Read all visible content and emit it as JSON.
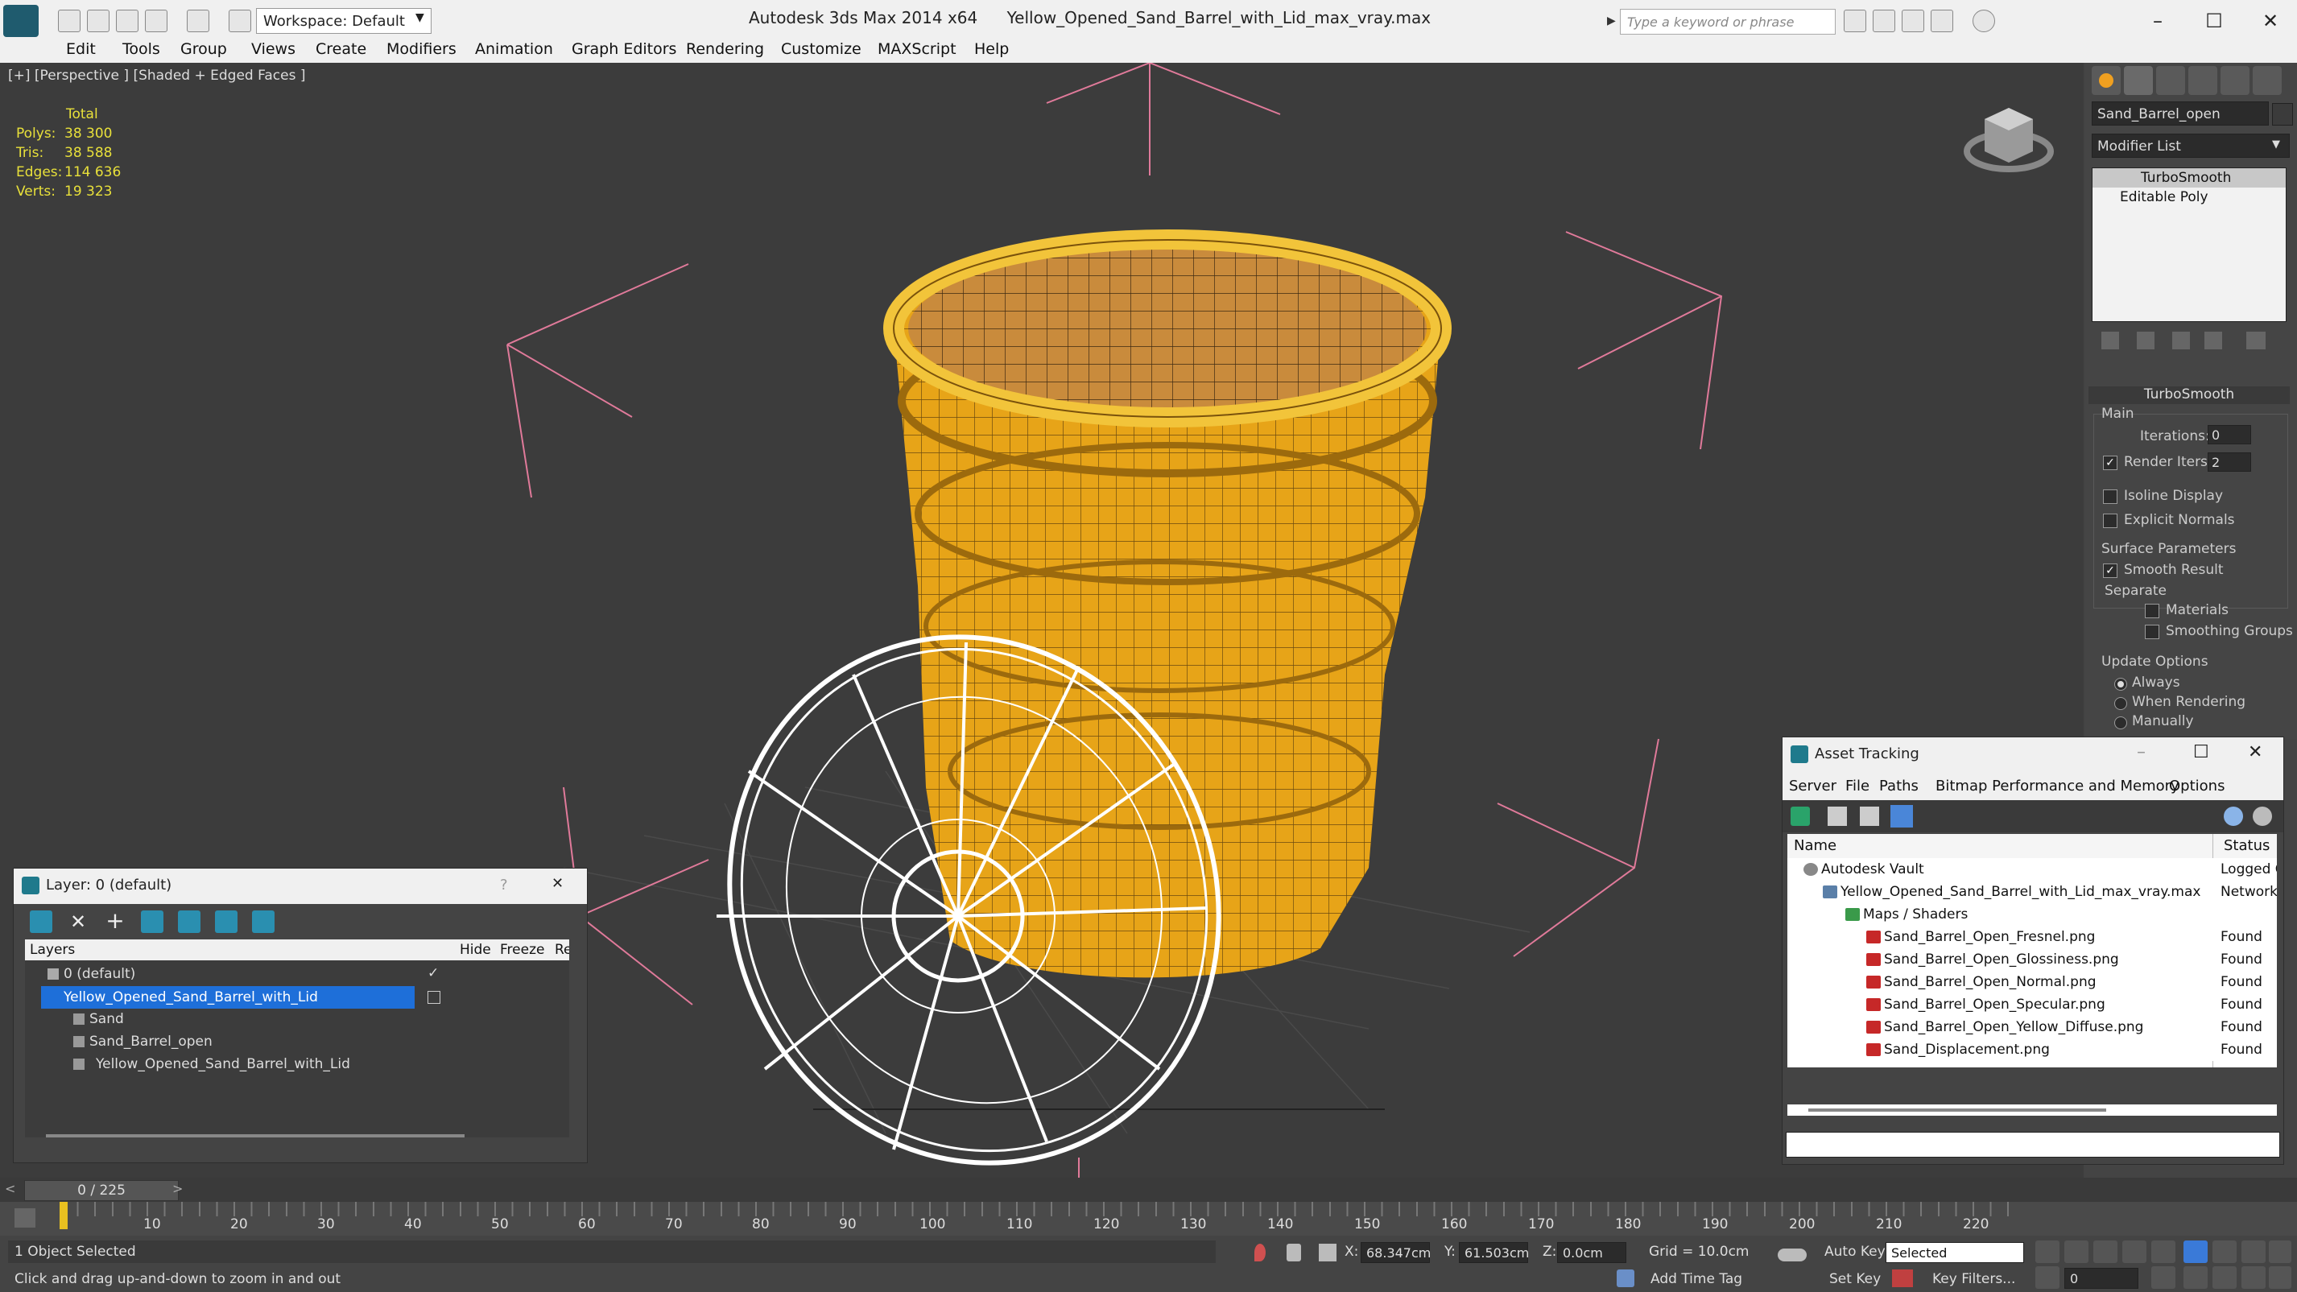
{
  "app": {
    "name": "Autodesk 3ds Max  2014 x64",
    "file": "Yellow_Opened_Sand_Barrel_with_Lid_max_vray.max",
    "workspace": "Workspace: Default",
    "search_placeholder": "Type a keyword or phrase"
  },
  "menu": [
    "Edit",
    "Tools",
    "Group",
    "Views",
    "Create",
    "Modifiers",
    "Animation",
    "Graph Editors",
    "Rendering",
    "Customize",
    "MAXScript",
    "Help"
  ],
  "viewport": {
    "label": "[+] [Perspective ] [Shaded + Edged Faces ]",
    "stats": {
      "total_label": "Total",
      "polys_label": "Polys:",
      "polys": "38 300",
      "tris_label": "Tris:",
      "tris": "38 588",
      "edges_label": "Edges:",
      "edges": "114 636",
      "verts_label": "Verts:",
      "verts": "19 323"
    },
    "colors": {
      "barrel": "#e7a418",
      "sand": "#c98b3c",
      "wire": "#ffffff",
      "gizmo": "#e07a9a"
    }
  },
  "command_panel": {
    "object_name": "Sand_Barrel_open",
    "modifier_list": "Modifier List",
    "stack": [
      "TurboSmooth",
      "Editable Poly"
    ],
    "rollout_title": "TurboSmooth",
    "main_label": "Main",
    "iterations_label": "Iterations:",
    "iterations": "0",
    "render_iters_label": "Render Iters:",
    "render_iters": "2",
    "isoline_label": "Isoline Display",
    "explicit_label": "Explicit Normals",
    "surface_label": "Surface Parameters",
    "smooth_result_label": "Smooth Result",
    "separate_label": "Separate",
    "materials_label": "Materials",
    "smoothing_label": "Smoothing Groups",
    "update_label": "Update Options",
    "always_label": "Always",
    "when_rendering_label": "When Rendering",
    "manually_label": "Manually"
  },
  "layer_panel": {
    "title": "Layer: 0 (default)",
    "help": "?",
    "close": "✕",
    "col_layers": "Layers",
    "col_hide": "Hide",
    "col_freeze": "Freeze",
    "col_render": "Rend",
    "rows": [
      {
        "name": "0 (default)",
        "check": "✓"
      },
      {
        "name": "Yellow_Opened_Sand_Barrel_with_Lid",
        "check": ""
      },
      {
        "name": "Sand",
        "check": ""
      },
      {
        "name": "Sand_Barrel_open",
        "check": ""
      },
      {
        "name": "Yellow_Opened_Sand_Barrel_with_Lid",
        "check": ""
      }
    ]
  },
  "asset_panel": {
    "title": "Asset Tracking",
    "menu": [
      "Server",
      "File",
      "Paths",
      "Bitmap Performance and Memory",
      "Options"
    ],
    "col_name": "Name",
    "col_status": "Status",
    "rows": [
      {
        "name": "Autodesk Vault",
        "status": "Logged O"
      },
      {
        "name": "Yellow_Opened_Sand_Barrel_with_Lid_max_vray.max",
        "status": "Network F"
      },
      {
        "name": "Maps / Shaders",
        "status": ""
      },
      {
        "name": "Sand_Barrel_Open_Fresnel.png",
        "status": "Found"
      },
      {
        "name": "Sand_Barrel_Open_Glossiness.png",
        "status": "Found"
      },
      {
        "name": "Sand_Barrel_Open_Normal.png",
        "status": "Found"
      },
      {
        "name": "Sand_Barrel_Open_Specular.png",
        "status": "Found"
      },
      {
        "name": "Sand_Barrel_Open_Yellow_Diffuse.png",
        "status": "Found"
      },
      {
        "name": "Sand_Displacement.png",
        "status": "Found"
      }
    ]
  },
  "timeline": {
    "frame": "0 / 225",
    "ticks": [
      "10",
      "20",
      "30",
      "40",
      "50",
      "60",
      "70",
      "80",
      "90",
      "100",
      "110",
      "120",
      "130",
      "140",
      "150",
      "160",
      "170",
      "180",
      "190",
      "200",
      "210",
      "220"
    ]
  },
  "status": {
    "selected": "1 Object Selected",
    "hint": "Click and drag up-and-down to zoom in and out",
    "x_label": "X:",
    "x": "68.347cm",
    "y_label": "Y:",
    "y": "61.503cm",
    "z_label": "Z:",
    "z": "0.0cm",
    "grid": "Grid = 10.0cm",
    "add_time_tag": "Add Time Tag",
    "auto_key": "Auto Key",
    "set_key": "Set Key",
    "selected_mode": "Selected",
    "key_filters": "Key Filters...",
    "frame_field": "0"
  }
}
